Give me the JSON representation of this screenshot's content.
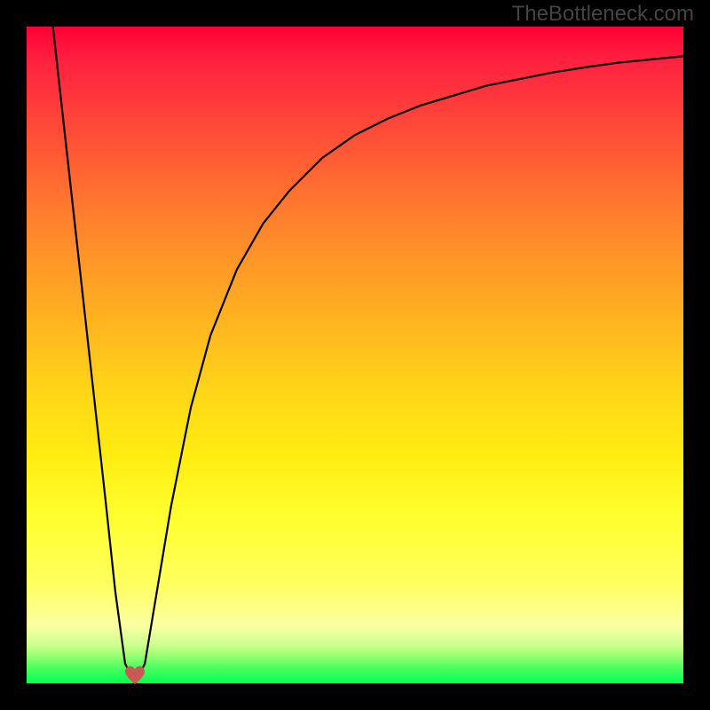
{
  "watermark": "TheBottleneck.com",
  "chart_data": {
    "type": "line",
    "title": "",
    "xlabel": "",
    "ylabel": "",
    "xlim": [
      0,
      100
    ],
    "ylim": [
      0,
      100
    ],
    "series": [
      {
        "name": "curve",
        "x": [
          4,
          6,
          8,
          10,
          12,
          13.5,
          15,
          16.5,
          18,
          20,
          22,
          25,
          28,
          32,
          36,
          40,
          45,
          50,
          55,
          60,
          65,
          70,
          75,
          80,
          85,
          90,
          95,
          100
        ],
        "values": [
          100,
          82,
          64,
          46,
          28,
          14,
          3,
          0,
          3,
          15,
          27,
          42,
          53,
          63,
          70,
          75,
          80,
          83.5,
          86,
          88,
          89.5,
          91,
          92,
          93,
          93.8,
          94.5,
          95,
          95.5
        ]
      }
    ],
    "heart_marker": {
      "x": 16.5,
      "y": 0
    },
    "gradient": {
      "type": "vertical",
      "stops": [
        {
          "pos": 0,
          "color": "#FF0033"
        },
        {
          "pos": 50,
          "color": "#FFB800"
        },
        {
          "pos": 80,
          "color": "#FFFF40"
        },
        {
          "pos": 100,
          "color": "#00FF50"
        }
      ]
    }
  }
}
